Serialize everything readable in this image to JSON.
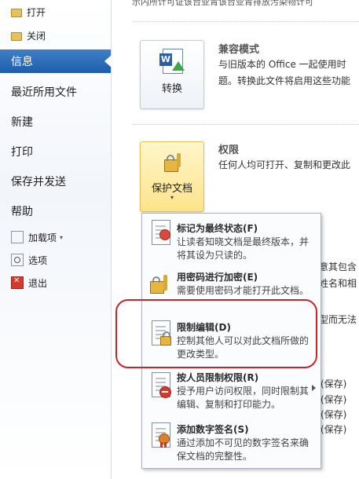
{
  "nav": {
    "open": "打开",
    "close": "关闭",
    "info": "信息",
    "recent": "最近所用文件",
    "new": "新建",
    "print": "打印",
    "save_send": "保存并发送",
    "help": "帮助",
    "addins": "加载项",
    "options": "选项",
    "exit": "退出"
  },
  "main": {
    "top_cut_text": "示内所计可证该台亚青该台亚青排放污染物计可",
    "compat": {
      "title": "兼容模式",
      "line1": "与旧版本的 Office 一起使用时",
      "line2": "题。转换此文件将启用这些功能",
      "button_label": "转换"
    },
    "permissions": {
      "title": "权限",
      "line1": "任何人均可打开、复制和更改此",
      "button_label": "保护文档"
    },
    "side_fragments": {
      "f1": "意其包含",
      "f2": "姓名和相",
      "f3": "型而无法",
      "p1": "(保存)",
      "p2": "(保存)",
      "p3": "(保存)",
      "p4": "(保存)"
    }
  },
  "menu": {
    "items": [
      {
        "title": "标记为最终状态(F)",
        "desc": "让读者知晓文档是最终版本，并将其设为只读的。"
      },
      {
        "title": "用密码进行加密(E)",
        "desc": "需要使用密码才能打开此文档。"
      },
      {
        "title": "限制编辑(D)",
        "desc": "控制其他人可以对此文档所做的更改类型。"
      },
      {
        "title": "按人员限制权限(R)",
        "desc": "授予用户访问权限，同时限制其编辑、复制和打印能力。"
      },
      {
        "title": "添加数字签名(S)",
        "desc": "通过添加不可见的数字签名来确保文档的完整性。"
      }
    ]
  }
}
